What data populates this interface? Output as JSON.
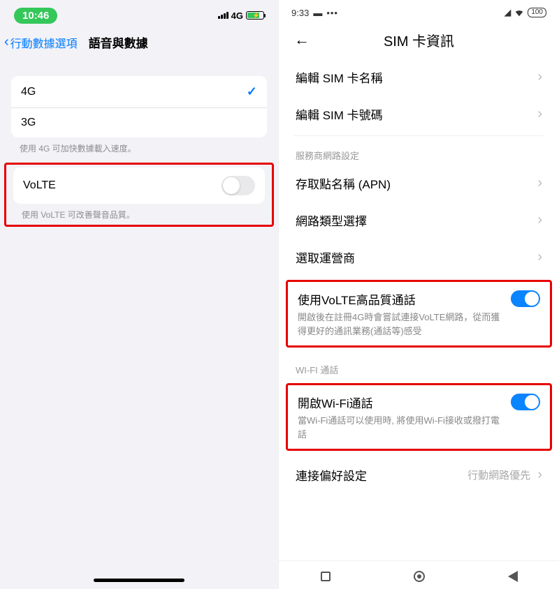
{
  "ios": {
    "time": "10:46",
    "net_label": "4G",
    "back_label": "行動數據選項",
    "title": "語音與數據",
    "opt_4g": "4G",
    "opt_3g": "3G",
    "footer_4g": "使用 4G 可加快數據載入速度。",
    "volte_label": "VoLTE",
    "footer_volte": "使用 VoLTE 可改善聲音品質。"
  },
  "and": {
    "time": "9:33",
    "batt": "100",
    "title": "SIM 卡資訊",
    "row_edit_name": "編輯 SIM 卡名稱",
    "row_edit_number": "編輯 SIM 卡號碼",
    "section_carrier": "服務商網路設定",
    "row_apn": "存取點名稱 (APN)",
    "row_net_type": "網路類型選擇",
    "row_operator": "選取運營商",
    "volte_title": "使用VoLTE高品質通話",
    "volte_sub": "開啟後在註冊4G時會嘗試連接VoLTE網路，從而獲得更好的通訊業務(通話等)感受",
    "section_wifi": "WI-FI 通話",
    "wifi_title": "開啟Wi-Fi通話",
    "wifi_sub": "當Wi-Fi通話可以使用時, 將使用Wi-Fi接收或撥打電話",
    "row_pref": "連接偏好設定",
    "row_pref_val": "行動網路優先"
  }
}
